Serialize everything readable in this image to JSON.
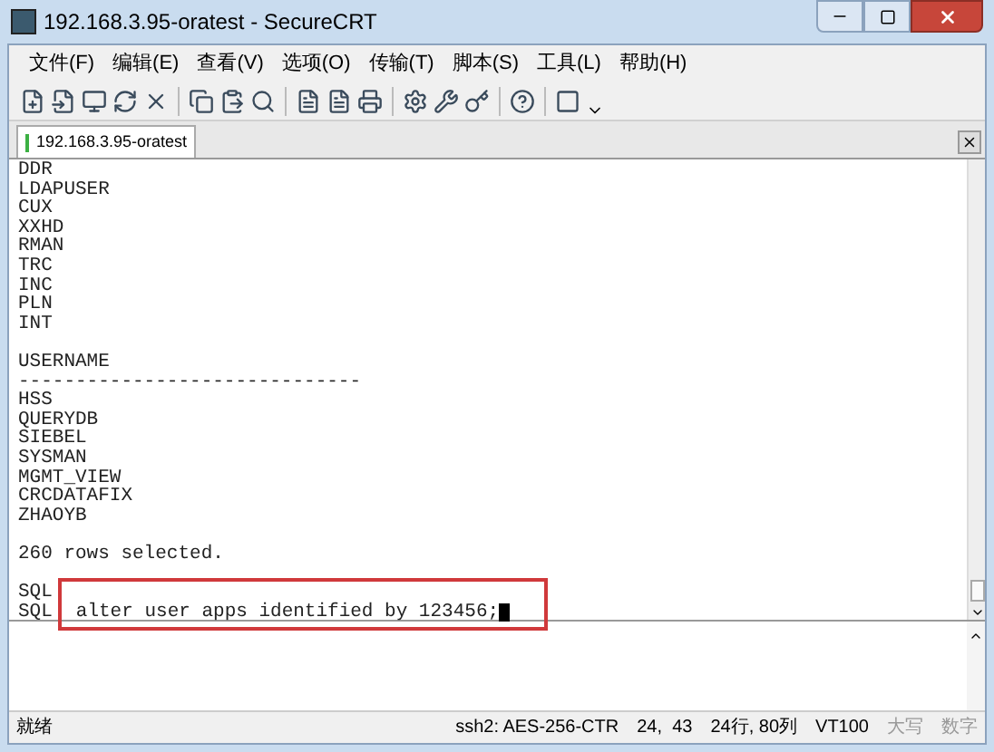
{
  "window": {
    "title": "192.168.3.95-oratest - SecureCRT"
  },
  "menu": [
    "文件(F)",
    "编辑(E)",
    "查看(V)",
    "选项(O)",
    "传输(T)",
    "脚本(S)",
    "工具(L)",
    "帮助(H)"
  ],
  "tabs": [
    {
      "label": "192.168.3.95-oratest",
      "selected": true
    }
  ],
  "terminal": {
    "blocks": [
      [
        "DDR",
        "LDAPUSER",
        "CUX",
        "XXHD",
        "RMAN",
        "TRC",
        "INC",
        "PLN",
        "INT"
      ],
      [
        "USERNAME",
        "------------------------------",
        "HSS",
        "QUERYDB",
        "SIEBEL",
        "SYSMAN",
        "MGMT_VIEW",
        "CRCDATAFIX",
        "ZHAOYB"
      ],
      [
        "260 rows selected."
      ]
    ],
    "prompt_lines": [
      {
        "prompt": "SQL"
      },
      {
        "prompt": "SQL",
        "command": "alter user apps identified by 123456;"
      }
    ]
  },
  "status_bar": {
    "message": "就绪",
    "fields": [
      "ssh2: AES-256-CTR",
      "24,  43",
      "24行, 80列",
      "VT100"
    ],
    "indicators": [
      {
        "label": "大写",
        "on": false
      },
      {
        "label": "数字",
        "on": false
      }
    ]
  }
}
